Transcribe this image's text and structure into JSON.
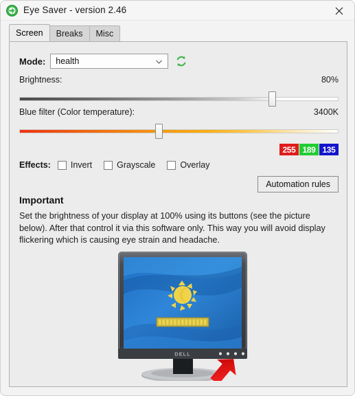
{
  "window": {
    "title": "Eye Saver - version 2.46",
    "app_icon": "shield-plus-icon",
    "close_label": "✕"
  },
  "tabs": [
    {
      "label": "Screen",
      "active": true
    },
    {
      "label": "Breaks",
      "active": false
    },
    {
      "label": "Misc",
      "active": false
    }
  ],
  "screen_tab": {
    "mode": {
      "label": "Mode:",
      "value": "health",
      "refresh_icon": "refresh-icon"
    },
    "brightness": {
      "label": "Brightness:",
      "value_text": "80%",
      "value": 80,
      "min": 0,
      "max": 100
    },
    "blue_filter": {
      "label": "Blue filter (Color temperature):",
      "value_text": "3400K",
      "value": 3400,
      "min": 1000,
      "max": 6500
    },
    "rgb_preview": [
      {
        "name": "red",
        "value": "255",
        "bg": "#e01b1b"
      },
      {
        "name": "green",
        "value": "189",
        "bg": "#22cc33"
      },
      {
        "name": "blue",
        "value": "135",
        "bg": "#1414cc"
      }
    ],
    "effects": {
      "label": "Effects:",
      "items": [
        {
          "label": "Invert",
          "checked": false
        },
        {
          "label": "Grayscale",
          "checked": false
        },
        {
          "label": "Overlay",
          "checked": false
        }
      ]
    },
    "automation_button": "Automation rules",
    "important": {
      "title": "Important",
      "body": "Set the brightness of your display at 100% using its buttons (see the picture below). After that control it via this software only. This way you will avoid display flickering which is causing eye strain and headache."
    },
    "illustration": {
      "name": "dell-monitor-picture",
      "brand": "DELL",
      "on_screen_icon": "brightness-sun-icon",
      "pointer": "red-arrow-icon"
    }
  },
  "colors": {
    "accent_green": "#3cb54a",
    "window_bg": "#f3f3f3",
    "panel_bg": "#ececec"
  }
}
